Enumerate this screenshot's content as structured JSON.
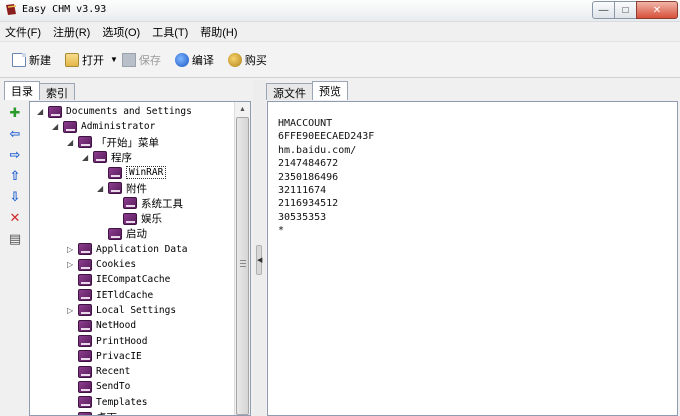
{
  "window": {
    "title": "Easy CHM v3.93",
    "min_glyph": "—",
    "max_glyph": "□",
    "close_glyph": "✕"
  },
  "menu": [
    "文件(F)",
    "注册(R)",
    "选项(O)",
    "工具(T)",
    "帮助(H)"
  ],
  "toolbar": {
    "new_label": "新建",
    "open_label": "打开",
    "dropdown_glyph": "▼",
    "save_label": "保存",
    "compile_label": "编译",
    "buy_label": "购买"
  },
  "left_tabs": [
    "目录",
    "索引"
  ],
  "side_icons": {
    "add": "✚",
    "left": "⇦",
    "right": "⇨",
    "up": "⇧",
    "down": "⇩",
    "delete": "✕",
    "properties": "▤"
  },
  "tree": [
    {
      "label": "Documents and Settings",
      "level": 0,
      "caret": "◢"
    },
    {
      "label": "Administrator",
      "level": 1,
      "caret": "◢"
    },
    {
      "label": "「开始」菜单",
      "level": 2,
      "caret": "◢",
      "cjk": true
    },
    {
      "label": "程序",
      "level": 3,
      "caret": "◢",
      "cjk": true
    },
    {
      "label": "WinRAR",
      "level": 4,
      "selected": true
    },
    {
      "label": "附件",
      "level": 4,
      "caret": "◢",
      "cjk": true
    },
    {
      "label": "系统工具",
      "level": 5,
      "cjk": true
    },
    {
      "label": "娱乐",
      "level": 5,
      "cjk": true
    },
    {
      "label": "启动",
      "level": 4,
      "cjk": true
    },
    {
      "label": "Application Data",
      "level": 2,
      "caret": "▷"
    },
    {
      "label": "Cookies",
      "level": 2,
      "caret": "▷"
    },
    {
      "label": "IECompatCache",
      "level": 2
    },
    {
      "label": "IETldCache",
      "level": 2
    },
    {
      "label": "Local Settings",
      "level": 2,
      "caret": "▷"
    },
    {
      "label": "NetHood",
      "level": 2
    },
    {
      "label": "PrintHood",
      "level": 2
    },
    {
      "label": "PrivacIE",
      "level": 2
    },
    {
      "label": "Recent",
      "level": 2
    },
    {
      "label": "SendTo",
      "level": 2
    },
    {
      "label": "Templates",
      "level": 2
    },
    {
      "label": "桌面",
      "level": 2,
      "cjk": true
    }
  ],
  "scrollbar": {
    "up": "▲",
    "down": "▼"
  },
  "right_tabs": [
    "源文件",
    "预览"
  ],
  "editor_lines": [
    "HMACCOUNT",
    "6FFE90EECAED243F",
    "hm.baidu.com/",
    "2147484672",
    "2350186496",
    "32111674",
    "2116934512",
    "30535353",
    "*"
  ]
}
